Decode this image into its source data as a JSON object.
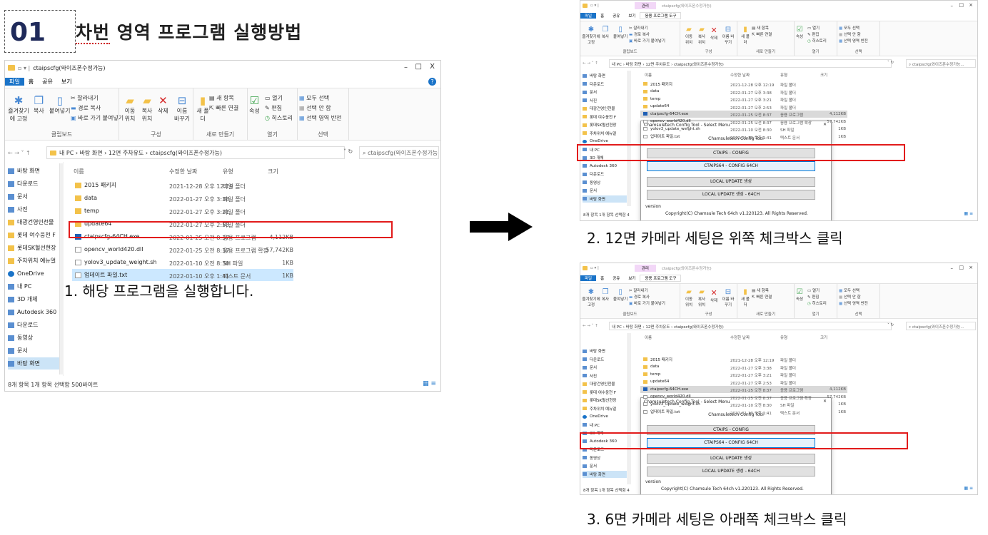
{
  "header": {
    "number": "01",
    "title_first": "차번",
    "title_rest": " 영역 프로그램 실행방법"
  },
  "steps": [
    {
      "caption": "1. 해당 프로그램을 실행합니다."
    },
    {
      "caption": "2. 12면 카메라 세팅은 위쪽 체크박스 클릭"
    },
    {
      "caption": "3. 6면 카메라 세팅은 아래쪽 체크박스 클릭"
    }
  ],
  "explorer": {
    "window_title": "ctaipscfg(와이즈폰수정가능)",
    "manage_tab": "관리",
    "app_tools_tab": "응용 프로그램 도구",
    "tabs": [
      "파일",
      "홈",
      "공유",
      "보기"
    ],
    "ribbon": {
      "clipboard": {
        "pin": "즐겨찾기에 고정",
        "copy": "복사",
        "paste": "붙여넣기",
        "cut": "잘라내기",
        "copy_path": "경로 복사",
        "paste_shortcut": "바로 가기 붙여넣기",
        "label": "클립보드"
      },
      "organize": {
        "move": "이동 위치",
        "copy_to": "복사 위치",
        "delete": "삭제",
        "rename": "이름 바꾸기",
        "label": "구성"
      },
      "new": {
        "new_folder": "새 폴더",
        "new_item": "새 항목",
        "easy_access": "빠른 연결",
        "label": "새로 만들기"
      },
      "open": {
        "properties": "속성",
        "open": "열기",
        "edit": "편집",
        "history": "히스토리",
        "label": "열기"
      },
      "select": {
        "select_all": "모두 선택",
        "select_none": "선택 안 함",
        "invert": "선택 영역 반전",
        "label": "선택"
      }
    },
    "path": "내 PC › 바탕 화면 › 12면 주차유도 › ctaipscfg(와이즈폰수정가능)",
    "search_placeholder": "ctaipscfg(와이즈폰수정가능...",
    "nav": [
      "바탕 화면",
      "다운로드",
      "문서",
      "사진",
      "대광건영인천물",
      "롯데 여수웅천 F",
      "롯데SK혈선현장",
      "주차위치 예뉴얼",
      "OneDrive",
      "내 PC",
      "3D 개체",
      "Autodesk 360",
      "다운로드",
      "동영상",
      "문서",
      "바탕 화면"
    ],
    "columns": [
      "이름",
      "수정한 날짜",
      "유형",
      "크기"
    ],
    "files": [
      {
        "name": "2015 패키지",
        "date": "2021-12-28 오후 12:19",
        "type": "파일 폴더",
        "size": ""
      },
      {
        "name": "data",
        "date": "2022-01-27 오후 3:38",
        "type": "파일 폴더",
        "size": ""
      },
      {
        "name": "temp",
        "date": "2022-01-27 오후 3:21",
        "type": "파일 폴더",
        "size": ""
      },
      {
        "name": "update64",
        "date": "2022-01-27 오후 2:53",
        "type": "파일 폴더",
        "size": ""
      },
      {
        "name": "ctaipscfg-64CH.exe",
        "date": "2022-01-25 오전 8:37",
        "type": "응용 프로그램",
        "size": "4,112KB"
      },
      {
        "name": "opencv_world420.dll",
        "date": "2022-01-25 오전 8:37",
        "type": "응용 프로그램 확장",
        "size": "57,742KB"
      },
      {
        "name": "yolov3_update_weight.sh",
        "date": "2022-01-10 오전 8:30",
        "type": "SH 파일",
        "size": "1KB"
      },
      {
        "name": "업데이트 파일.txt",
        "date": "2022-01-10 오후 1:41",
        "type": "텍스트 문서",
        "size": "1KB"
      }
    ],
    "status": "8개 항목   1개 항목 선택함 500바이트",
    "status_small": "8개 항목   1개 항목 선택함 4"
  },
  "dialog": {
    "title": "Chamsuletech Config Tool - Select Menu",
    "heading": "Chamsuletech Config Tool",
    "buttons": [
      "CTAIPS - CONFIG",
      "CTAIPS64 - CONFIG 64CH",
      "LOCAL UPDATE 생성",
      "LOCAL UPDATE 생성 - 64CH"
    ],
    "version_label": "version",
    "copyright": "Copyright(C) Chamsule Tech 64ch v1.220123. All Rights Reserved."
  },
  "colors": {
    "highlight_red": "#e21b1b",
    "number_navy": "#1f2a5a",
    "accent_blue": "#1a73c8"
  }
}
